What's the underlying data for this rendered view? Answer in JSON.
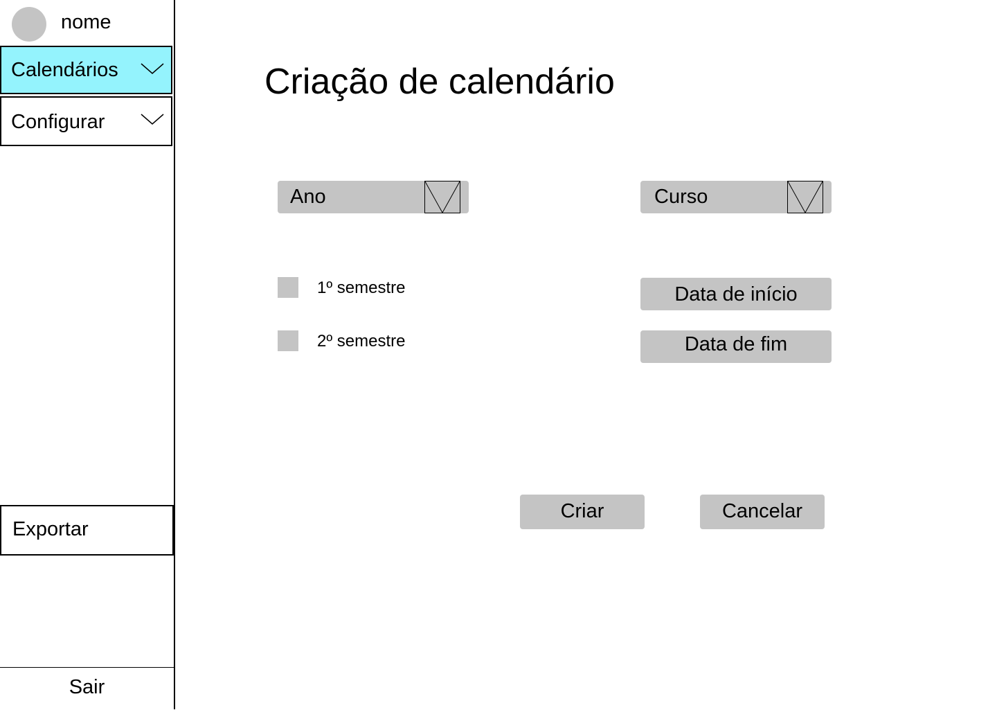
{
  "sidebar": {
    "user_name": "nome",
    "nav": [
      {
        "label": "Calendários",
        "active": true
      },
      {
        "label": "Configurar",
        "active": false
      }
    ],
    "export_label": "Exportar",
    "logout_label": "Sair",
    "active_color": "#94f3fd"
  },
  "main": {
    "title": "Criação de calendário",
    "year_select": {
      "label": "Ano"
    },
    "course_select": {
      "label": "Curso"
    },
    "semesters": [
      {
        "label": "1º semestre",
        "checked": false
      },
      {
        "label": "2º semestre",
        "checked": false
      }
    ],
    "start_date_label": "Data de início",
    "end_date_label": "Data de fim",
    "create_label": "Criar",
    "cancel_label": "Cancelar"
  },
  "icons": {
    "chevron": "chevron-down-icon",
    "dropdown": "dropdown-arrow-icon",
    "avatar": "avatar"
  }
}
